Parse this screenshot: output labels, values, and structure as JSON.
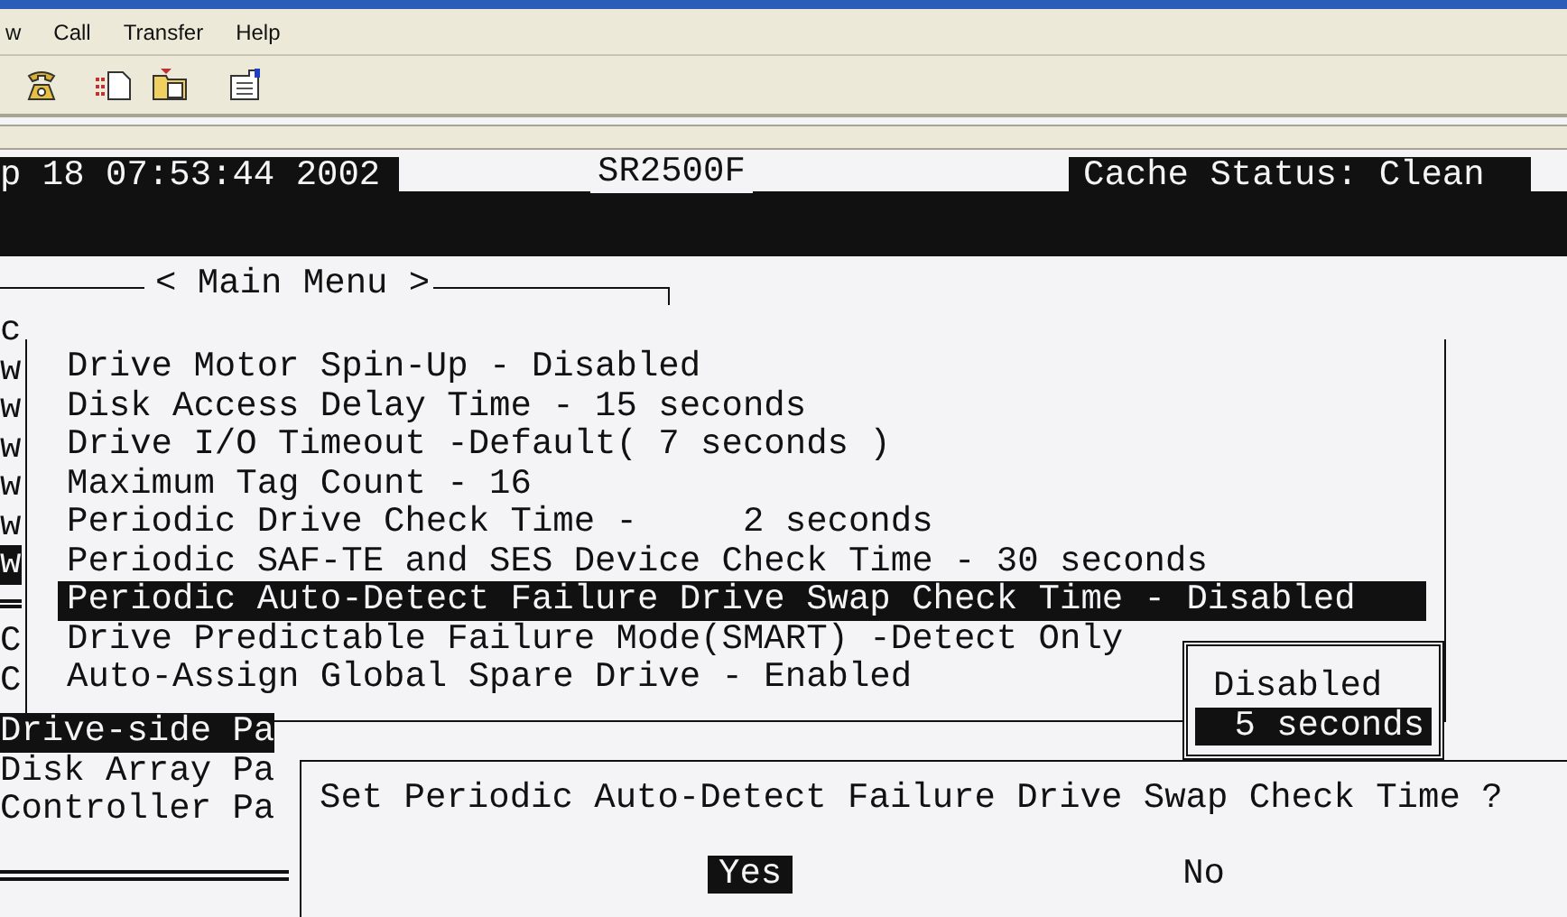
{
  "menu_bar": [
    {
      "label": "w"
    },
    {
      "label": "Call"
    },
    {
      "label": "Transfer"
    },
    {
      "label": "Help"
    }
  ],
  "status": {
    "datetime": "p 18 07:53:44 2002",
    "model": "SR2500F",
    "cache": "Cache Status: Clean"
  },
  "main_menu_title": "< Main Menu >",
  "background_menu_top": [
    {
      "label": "c",
      "selected": false
    },
    {
      "label": "w",
      "selected": false
    },
    {
      "label": "w",
      "selected": false
    },
    {
      "label": "w",
      "selected": false
    },
    {
      "label": "w",
      "selected": false
    },
    {
      "label": "w",
      "selected": false
    },
    {
      "label": "w",
      "selected": true
    }
  ],
  "background_menu_bottom": [
    {
      "label": "C",
      "selected": false
    },
    {
      "label": "C",
      "selected": false
    }
  ],
  "drive_side_menu": {
    "items": [
      {
        "label": "Drive Motor Spin-Up - Disabled",
        "selected": false
      },
      {
        "label": "Disk Access Delay Time - 15 seconds",
        "selected": false
      },
      {
        "label": "Drive I/O Timeout -Default( 7 seconds )",
        "selected": false
      },
      {
        "label": "Maximum Tag Count - 16",
        "selected": false
      },
      {
        "label": "Periodic Drive Check Time -     2 seconds",
        "selected": false
      },
      {
        "label": "Periodic SAF-TE and SES Device Check Time - 30 seconds",
        "selected": false
      },
      {
        "label": "Periodic Auto-Detect Failure Drive Swap Check Time - Disabled",
        "selected": true
      },
      {
        "label": "Drive Predictable Failure Mode(SMART) -Detect Only",
        "selected": false
      },
      {
        "label": "Auto-Assign Global Spare Drive - Enabled",
        "selected": false
      }
    ]
  },
  "options": [
    {
      "label": "Disabled",
      "selected": false
    },
    {
      "label": " 5 seconds",
      "selected": true
    }
  ],
  "parameters_menu": [
    {
      "label": "Drive-side Pa",
      "selected": true
    },
    {
      "label": "Disk Array Pa",
      "selected": false
    },
    {
      "label": "Controller Pa",
      "selected": false
    }
  ],
  "dialog": {
    "question": "Set Periodic Auto-Detect Failure Drive Swap Check Time ?",
    "buttons": [
      {
        "label": "Yes",
        "selected": true
      },
      {
        "label": "No",
        "selected": false
      }
    ]
  }
}
